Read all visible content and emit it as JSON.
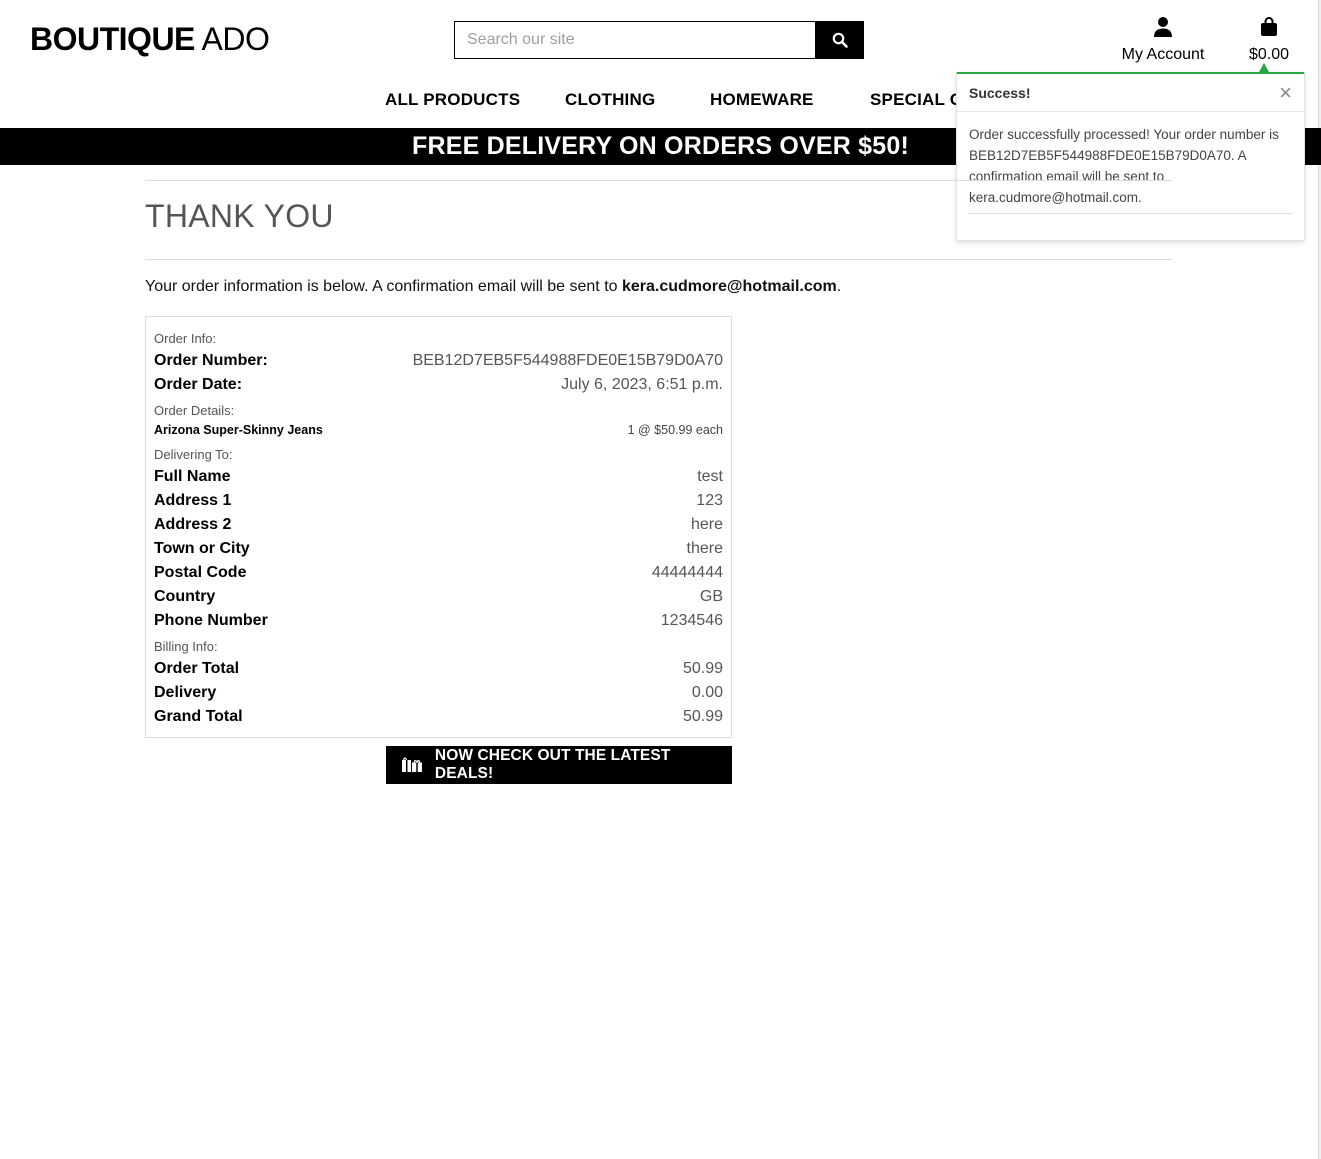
{
  "header": {
    "logo_bold": "BOUTIQUE",
    "logo_light": "ADO",
    "search_placeholder": "Search our site",
    "account_label": "My Account",
    "bag_total": "$0.00"
  },
  "nav": {
    "items": [
      "ALL PRODUCTS",
      "CLOTHING",
      "HOMEWARE",
      "SPECIAL OF"
    ]
  },
  "banner": "FREE DELIVERY ON ORDERS OVER $50!",
  "toast": {
    "title": "Success!",
    "close": "×",
    "message": "Order successfully processed! Your order number is BEB12D7EB5F544988FDE0E15B79D0A70. A confirmation email will be sent to kera.cudmore@hotmail.com.",
    "accent_color": "#28a745"
  },
  "page": {
    "title": "THANK YOU",
    "intro_text": "Your order information is below. A confirmation email will be sent to ",
    "intro_email": "kera.cudmore@hotmail.com",
    "intro_end": "."
  },
  "order": {
    "info_label": "Order Info:",
    "number_label": "Order Number:",
    "number": "BEB12D7EB5F544988FDE0E15B79D0A70",
    "date_label": "Order Date:",
    "date": "July 6, 2023, 6:51 p.m.",
    "details_label": "Order Details:",
    "item_name": "Arizona Super-Skinny Jeans",
    "item_qty": "1 @ $50.99 each",
    "delivering_label": "Delivering To:",
    "full_name_label": "Full Name",
    "full_name": "test",
    "address1_label": "Address 1",
    "address1": "123",
    "address2_label": "Address 2",
    "address2": "here",
    "town_label": "Town or City",
    "town": "there",
    "postal_label": "Postal Code",
    "postal": "44444444",
    "country_label": "Country",
    "country": "GB",
    "phone_label": "Phone Number",
    "phone": "1234546",
    "billing_label": "Billing Info:",
    "order_total_label": "Order Total",
    "order_total": "50.99",
    "delivery_label": "Delivery",
    "delivery": "0.00",
    "grand_total_label": "Grand Total",
    "grand_total": "50.99"
  },
  "deals_button": "NOW CHECK OUT THE LATEST DEALS!"
}
